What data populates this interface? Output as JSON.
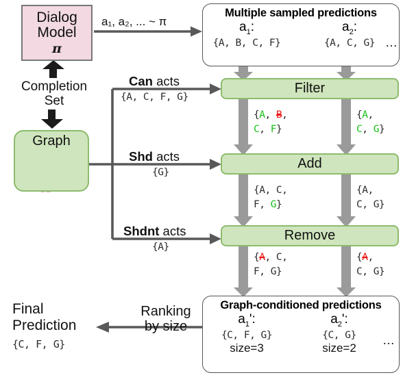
{
  "dialog_model": {
    "line1": "Dialog",
    "line2": "Model",
    "policy": "π"
  },
  "sampling_label": "a₁, a₂, ... ~ π",
  "completion_set": {
    "line1": "Completion",
    "line2": "Set"
  },
  "graph": {
    "label": "Graph"
  },
  "top_panel": {
    "title": "Multiple sampled predictions",
    "slots": [
      {
        "name": "a",
        "sub": "1",
        "suffix": ":",
        "set": "{A, B, C, F}"
      },
      {
        "name": "a",
        "sub": "2",
        "suffix": ":",
        "set": "{A, C, G}"
      }
    ],
    "ellipsis": "…"
  },
  "processes": [
    {
      "name": "filter",
      "label": "Filter"
    },
    {
      "name": "add",
      "label": "Add"
    },
    {
      "name": "remove",
      "label": "Remove"
    }
  ],
  "graph_inputs": [
    {
      "bold": "Can",
      "rest": " acts",
      "set": "{A, C, F, G}"
    },
    {
      "bold": "Shd",
      "rest": " acts",
      "set": "{G}"
    },
    {
      "bold": "Shdnt",
      "rest": " acts",
      "set": "{A}"
    }
  ],
  "flow": {
    "after_filter": {
      "left_line1": [
        {
          "t": "{",
          "c": "plain"
        },
        {
          "t": "A",
          "c": "green"
        },
        {
          "t": ", ",
          "c": "plain"
        },
        {
          "t": "B",
          "c": "red-strike"
        },
        {
          "t": ",",
          "c": "plain"
        }
      ],
      "left_line2": [
        {
          "t": "C",
          "c": "green"
        },
        {
          "t": ", ",
          "c": "plain"
        },
        {
          "t": "F",
          "c": "green"
        },
        {
          "t": "}",
          "c": "plain"
        }
      ],
      "right_line1": [
        {
          "t": "{",
          "c": "plain"
        },
        {
          "t": "A",
          "c": "green"
        },
        {
          "t": ",",
          "c": "plain"
        }
      ],
      "right_line2": [
        {
          "t": "C",
          "c": "green"
        },
        {
          "t": ", ",
          "c": "plain"
        },
        {
          "t": "G",
          "c": "green"
        },
        {
          "t": "}",
          "c": "plain"
        }
      ]
    },
    "after_add": {
      "left_line1": [
        {
          "t": "{A, C,",
          "c": "plain"
        }
      ],
      "left_line2": [
        {
          "t": "F, ",
          "c": "plain"
        },
        {
          "t": "G",
          "c": "green"
        },
        {
          "t": "}",
          "c": "plain"
        }
      ],
      "right_line1": [
        {
          "t": "{A,",
          "c": "plain"
        }
      ],
      "right_line2": [
        {
          "t": "C, G}",
          "c": "plain"
        }
      ]
    },
    "after_remove": {
      "left_line1": [
        {
          "t": "{",
          "c": "plain"
        },
        {
          "t": "A",
          "c": "red-strike"
        },
        {
          "t": ", C,",
          "c": "plain"
        }
      ],
      "left_line2": [
        {
          "t": "F, G}",
          "c": "plain"
        }
      ],
      "right_line1": [
        {
          "t": "{",
          "c": "plain"
        },
        {
          "t": "A",
          "c": "red-strike"
        },
        {
          "t": ",",
          "c": "plain"
        }
      ],
      "right_line2": [
        {
          "t": "C, G}",
          "c": "plain"
        }
      ]
    }
  },
  "bottom_panel": {
    "title": "Graph-conditioned predictions",
    "slots": [
      {
        "name": "a",
        "sub": "1",
        "suffix": "':",
        "set": "{C, F, G}",
        "size": "size=3"
      },
      {
        "name": "a",
        "sub": "2",
        "suffix": "':",
        "set": "{C, G}",
        "size": "size=2"
      }
    ],
    "ellipsis": "…"
  },
  "ranking": {
    "line1": "Ranking",
    "line2": "by size"
  },
  "final": {
    "line1": "Final",
    "line2": "Prediction",
    "set": "{C, F, G}"
  },
  "colors": {
    "dialog_fill": "#f2d9e2",
    "process_fill": "#cfe5bd",
    "process_border": "#8cbb6e",
    "arrow_gray": "#9a9a9a",
    "connector_gray": "#595959",
    "added": "#17c017",
    "removed": "#ee1111"
  }
}
